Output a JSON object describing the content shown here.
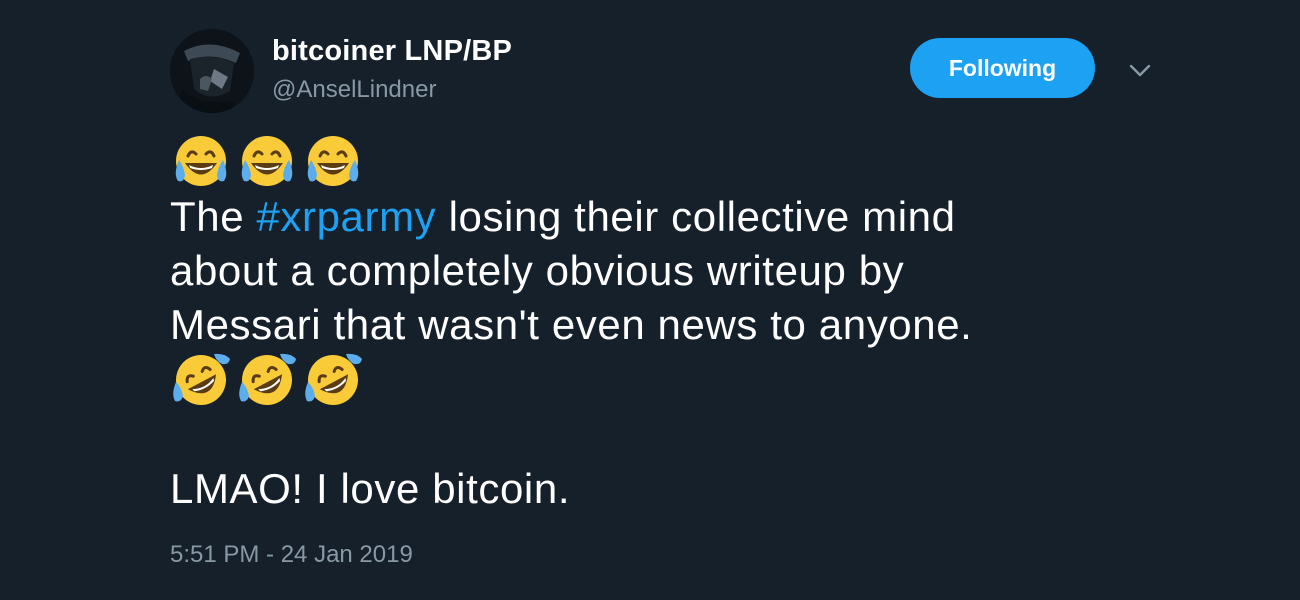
{
  "author": {
    "display_name": "bitcoiner LNP/BP",
    "handle": "@AnselLindner"
  },
  "follow_button": {
    "label": "Following"
  },
  "tweet": {
    "emoji_row_1": [
      "face-with-tears-of-joy",
      "face-with-tears-of-joy",
      "face-with-tears-of-joy"
    ],
    "line1_pre": "The ",
    "hashtag": "#xrparmy",
    "line1_post": " losing their collective mind",
    "line2": "about a completely obvious writeup by",
    "line3": "Messari that wasn't even news to anyone.",
    "emoji_row_2": [
      "rolling-on-the-floor-laughing",
      "rolling-on-the-floor-laughing",
      "rolling-on-the-floor-laughing"
    ],
    "line4": "LMAO! I love bitcoin."
  },
  "timestamp": "5:51 PM - 24 Jan 2019",
  "colors": {
    "background": "#15202b",
    "accent": "#1da1f2",
    "secondary_text": "#8899a6"
  }
}
